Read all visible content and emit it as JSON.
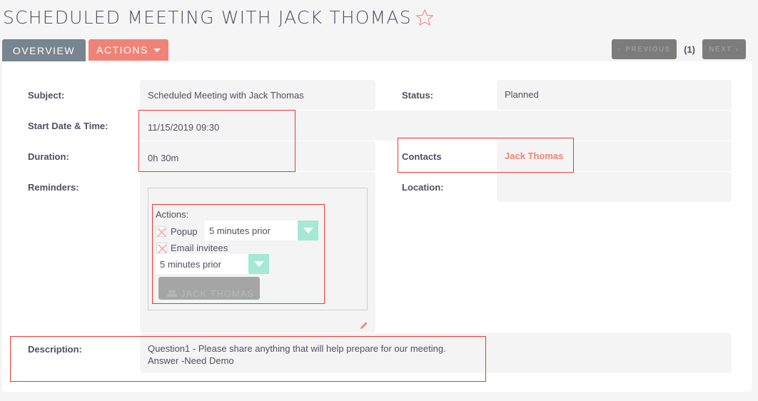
{
  "header": {
    "title": "SCHEDULED MEETING WITH JACK THOMAS",
    "favorite_icon": "star-outline-icon"
  },
  "tabs": [
    {
      "label": "OVERVIEW",
      "active": true
    },
    {
      "label": "ACTIONS",
      "icon": "caret-down-icon"
    }
  ],
  "pager": {
    "previous_label": "PREVIOUS",
    "count": "(1)",
    "next_label": "NEXT"
  },
  "fields": {
    "subject": {
      "label": "Subject:",
      "value": "Scheduled Meeting with Jack Thomas"
    },
    "status": {
      "label": "Status:",
      "value": "Planned"
    },
    "start": {
      "label": "Start Date & Time:",
      "value": "11/15/2019 09:30"
    },
    "duration": {
      "label": "Duration:",
      "value": "0h 30m"
    },
    "contacts": {
      "label": "Contacts",
      "value": "Jack Thomas"
    },
    "reminders": {
      "label": "Reminders:"
    },
    "location": {
      "label": "Location:",
      "value": ""
    },
    "description": {
      "label": "Description:",
      "line1": "Question1 - Please share anything that will help prepare for our meeting.",
      "line2": "Answer -Need Demo"
    }
  },
  "reminder": {
    "actions_label": "Actions:",
    "popup_label": "Popup",
    "popup_select": "5 minutes prior",
    "email_label": "Email invitees",
    "email_select": "5 minutes prior",
    "invitee_button": "JACK THOMAS"
  },
  "colors": {
    "accent": "#f08377",
    "tab_overview": "#778591",
    "select_arrow": "#a5e8d6",
    "highlight": "#e53935"
  }
}
